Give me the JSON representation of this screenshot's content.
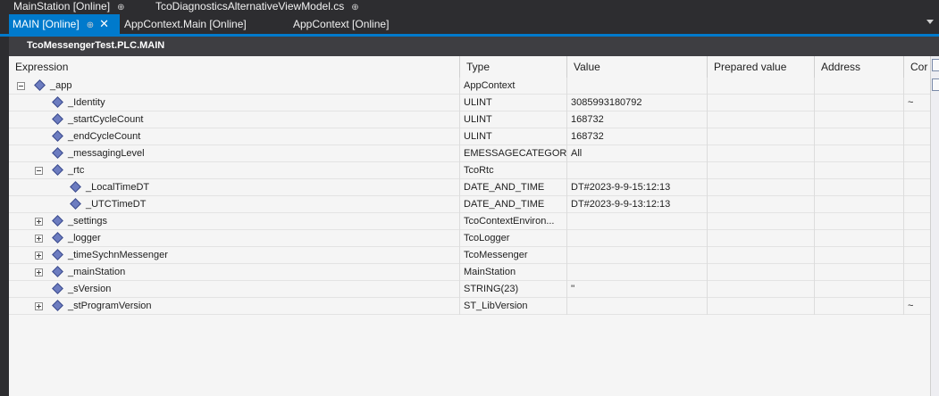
{
  "tabs_row1": [
    {
      "label": "MainStation [Online]",
      "pinned": true
    },
    {
      "label": "TcoDiagnosticsAlternativeViewModel.cs",
      "pinned": true
    }
  ],
  "tabs_row2": [
    {
      "label": "MAIN [Online]",
      "active": true,
      "pinned": true,
      "closable": true
    },
    {
      "label": "AppContext.Main [Online]",
      "active": false
    },
    {
      "label": "AppContext [Online]",
      "active": false
    }
  ],
  "pin_glyph": "⊕",
  "close_glyph": "✕",
  "path_title": "TcoMessengerTest.PLC.MAIN",
  "columns": [
    "Expression",
    "Type",
    "Value",
    "Prepared value",
    "Address",
    "Cor"
  ],
  "rows": [
    {
      "name": "_app",
      "type": "AppContext",
      "value": "",
      "comment": "",
      "level": 0,
      "expander": "minus"
    },
    {
      "name": "_Identity",
      "type": "ULINT",
      "value": "3085993180792",
      "comment": "~",
      "level": 1,
      "expander": ""
    },
    {
      "name": "_startCycleCount",
      "type": "ULINT",
      "value": "168732",
      "comment": "",
      "level": 1,
      "expander": ""
    },
    {
      "name": "_endCycleCount",
      "type": "ULINT",
      "value": "168732",
      "comment": "",
      "level": 1,
      "expander": ""
    },
    {
      "name": "_messagingLevel",
      "type": "EMESSAGECATEGORY",
      "value": "All",
      "comment": "",
      "level": 1,
      "expander": ""
    },
    {
      "name": "_rtc",
      "type": "TcoRtc",
      "value": "",
      "comment": "",
      "level": 1,
      "expander": "minus"
    },
    {
      "name": "_LocalTimeDT",
      "type": "DATE_AND_TIME",
      "value": "DT#2023-9-9-15:12:13",
      "comment": "",
      "level": 2,
      "expander": ""
    },
    {
      "name": "_UTCTimeDT",
      "type": "DATE_AND_TIME",
      "value": "DT#2023-9-9-13:12:13",
      "comment": "",
      "level": 2,
      "expander": ""
    },
    {
      "name": "_settings",
      "type": "TcoContextEnviron...",
      "value": "",
      "comment": "",
      "level": 1,
      "expander": "plus"
    },
    {
      "name": "_logger",
      "type": "TcoLogger",
      "value": "",
      "comment": "",
      "level": 1,
      "expander": "plus"
    },
    {
      "name": "_timeSychnMessenger",
      "type": "TcoMessenger",
      "value": "",
      "comment": "",
      "level": 1,
      "expander": "plus"
    },
    {
      "name": "_mainStation",
      "type": "MainStation",
      "value": "",
      "comment": "",
      "level": 1,
      "expander": "plus"
    },
    {
      "name": "_sVersion",
      "type": "STRING(23)",
      "value": "''",
      "comment": "",
      "level": 1,
      "expander": ""
    },
    {
      "name": "_stProgramVersion",
      "type": "ST_LibVersion",
      "value": "",
      "comment": "~",
      "level": 1,
      "expander": "plus"
    }
  ],
  "colors": {
    "accent": "#007acc",
    "chrome": "#2d2d30",
    "grid_bg": "#f5f5f5",
    "var_icon": "#6c7cc0"
  }
}
